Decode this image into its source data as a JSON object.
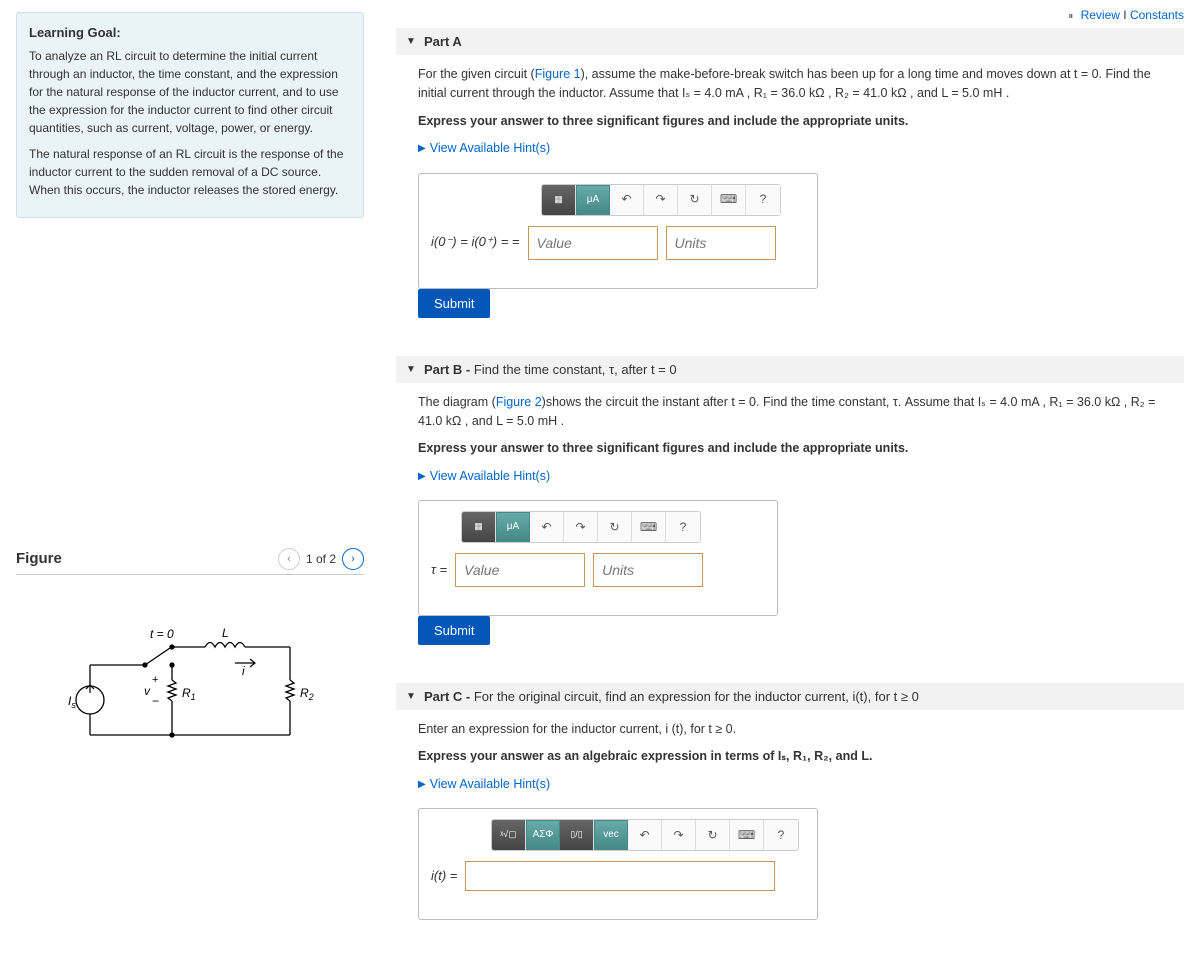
{
  "topLinks": {
    "review": "Review",
    "constants": "Constants"
  },
  "learningGoal": {
    "heading": "Learning Goal:",
    "p1": "To analyze an RL circuit to determine the initial current through an inductor, the time constant, and the expression for the natural response of the inductor current, and to use the expression for the inductor current to find other circuit quantities, such as current, voltage, power, or energy.",
    "p2": "The natural response of an RL circuit is the response of the inductor current to the sudden removal of a DC source. When this occurs, the inductor releases the stored energy."
  },
  "figure": {
    "title": "Figure",
    "pager": "1 of 2"
  },
  "circuit": {
    "t0": "t = 0",
    "L": "L",
    "i": "i",
    "Is": "I",
    "IsSub": "s",
    "v": "v",
    "plus": "+",
    "minus": "−",
    "R1": "R",
    "R1sub": "1",
    "R2": "R",
    "R2sub": "2"
  },
  "partA": {
    "title": "Part A",
    "text1a": "For the given circuit (",
    "figLink": "Figure 1",
    "text1b": "), assume the make-before-break switch has been up for a long time and moves down at t = 0.  Find the initial current through the inductor. Assume that Iₛ = 4.0 mA , R₁ = 36.0 kΩ , R₂ = 41.0 kΩ , and L = 5.0 mH .",
    "instr": "Express your answer to three significant figures and include the appropriate units.",
    "hints": "View Available Hint(s)",
    "eqLabel": "i(0⁻) = i(0⁺) = =",
    "valPlaceholder": "Value",
    "unitPlaceholder": "Units",
    "submit": "Submit"
  },
  "partB": {
    "titleStrong": "Part B - ",
    "titleRest": "Find the time constant, τ, after t = 0",
    "text1a": "The diagram (",
    "figLink": "Figure 2",
    "text1b": ")shows the circuit the instant after t = 0. Find the time constant, τ. Assume that Iₛ = 4.0 mA , R₁ = 36.0 kΩ , R₂ = 41.0 kΩ , and L = 5.0 mH .",
    "instr": "Express your answer to three significant figures and include the appropriate units.",
    "hints": "View Available Hint(s)",
    "eqLabel": "τ =",
    "valPlaceholder": "Value",
    "unitPlaceholder": "Units",
    "submit": "Submit"
  },
  "partC": {
    "titleStrong": "Part C - ",
    "titleRest": "For the original circuit, find an expression for the inductor current, i(t), for t ≥ 0",
    "text1": "Enter an expression for the inductor current, i (t), for t ≥ 0.",
    "instr": "Express your answer as an algebraic expression in terms of Iₛ, R₁, R₂, and L.",
    "hints": "View Available Hint(s)",
    "eqLabel": "i(t) ="
  },
  "tools": {
    "mu": "μA",
    "undo": "↶",
    "redo": "↷",
    "reset": "↻",
    "kbd": "⌨",
    "help": "?",
    "sqrt": "ᵡ√▢",
    "sigma": "ΑΣΦ",
    "frac": "▯/▯",
    "vec": "vec"
  }
}
